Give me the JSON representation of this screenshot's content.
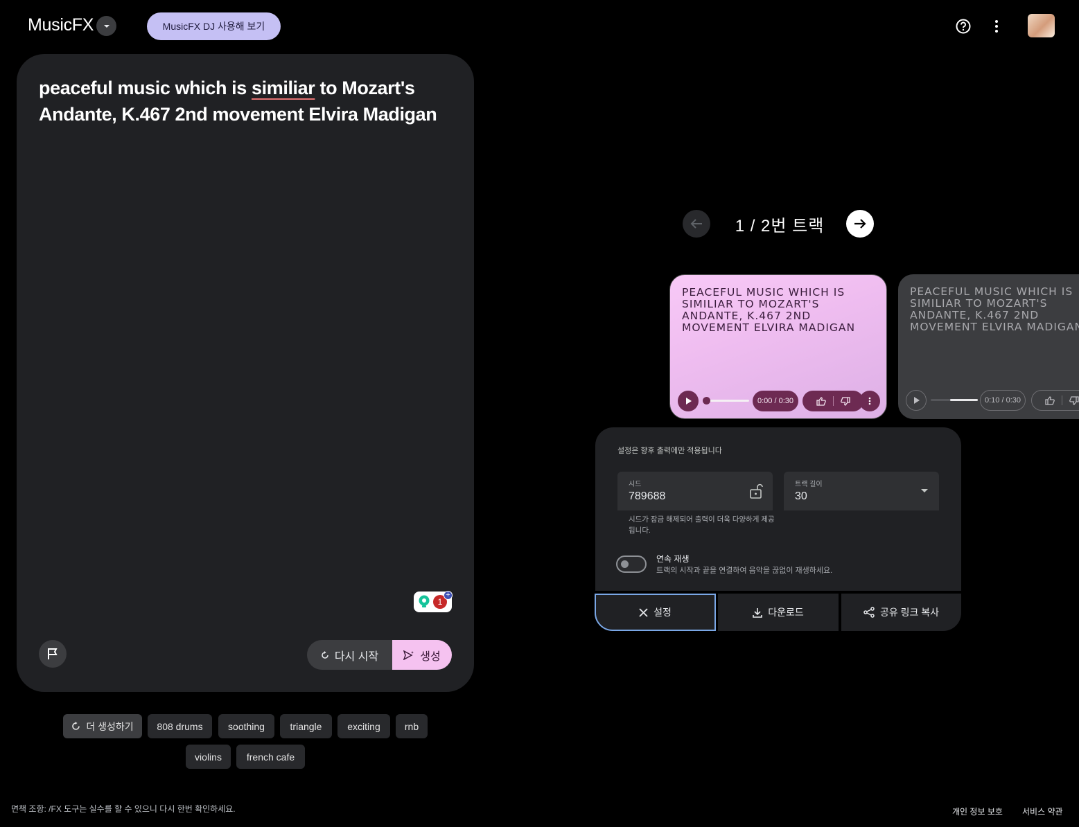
{
  "header": {
    "logo": "MusicFX",
    "dj_button": "MusicFX DJ 사용해 보기"
  },
  "prompt": {
    "part1": "peaceful music which is ",
    "misspelled": "similiar",
    "part2": " to Mozart's Andante, K.467 2nd movement Elvira Madigan",
    "grammar_badge_count": "1",
    "reset_label": "다시 시작",
    "generate_label": "생성"
  },
  "chips": {
    "more_label": "더 생성하기",
    "items": [
      "808 drums",
      "soothing",
      "triangle",
      "exciting",
      "rnb",
      "violins",
      "french cafe"
    ]
  },
  "tracks": {
    "label": "1 / 2번  트랙",
    "cards": [
      {
        "title": "peaceful music which is similiar to Mozart's Andante, K.467 2nd movement Elvira Madigan",
        "time": "0:00 / 0:30",
        "progress": 0.0
      },
      {
        "title": "peaceful music which is similiar to Mozart's Andante, K.467 2nd movement Elvira Madigan",
        "time": "0:10 / 0:30",
        "progress": 0.33
      }
    ]
  },
  "settings": {
    "note": "설정은 향후 출력에만 적용됩니다",
    "seed_label": "시드",
    "seed_value": "789688",
    "seed_help": "시드가 잠금 해제되어 출력이 더욱 다양하게 제공됩니다.",
    "length_label": "트랙 길이",
    "length_value": "30",
    "loop_title": "연속 재생",
    "loop_desc": "트랙의 시작과 끝을 연결하여 음악을 끊없이 재생하세요.",
    "loop_enabled": false
  },
  "actions": {
    "close_label": "설정",
    "download_label": "다운로드",
    "share_label": "공유 링크 복사"
  },
  "footer": {
    "disclaimer": "면책 조항: /FX 도구는 실수를 할 수 있으니 다시 한번 확인하세요.",
    "privacy": "개인 정보 보호",
    "terms": "서비스 약관"
  },
  "colors": {
    "accent_pink": "#f5c2f0",
    "accent_lavender": "#c5c0f4",
    "card_bg": "#202124"
  }
}
